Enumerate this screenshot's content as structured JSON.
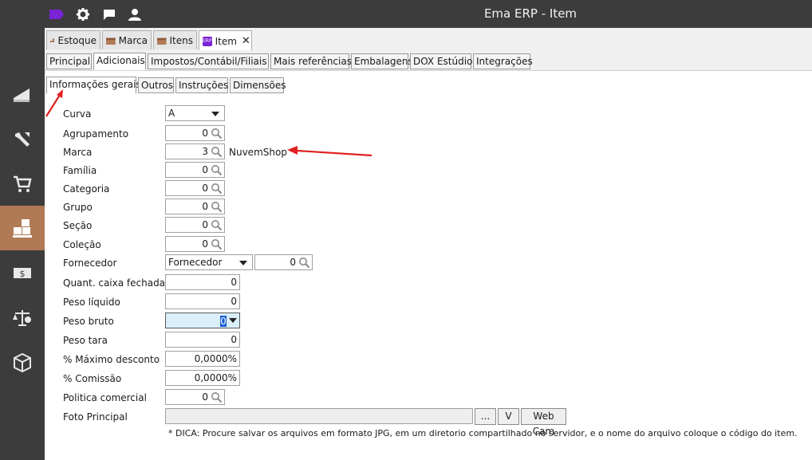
{
  "window": {
    "title": "Ema ERP - Item"
  },
  "doc_tabs": [
    {
      "label": "Estoque"
    },
    {
      "label": "Marca"
    },
    {
      "label": "Itens"
    },
    {
      "label": "Item",
      "badge": "ERP",
      "close": "✕"
    }
  ],
  "main_tabs": [
    {
      "label": "Principal"
    },
    {
      "label": "Adicionais"
    },
    {
      "label": "Impostos/Contábil/Filiais"
    },
    {
      "label": "Mais referências"
    },
    {
      "label": "Embalagens"
    },
    {
      "label": "DOX Estúdio"
    },
    {
      "label": "Integrações"
    }
  ],
  "sub_tabs": [
    {
      "label": "Informações gerais"
    },
    {
      "label": "Outros"
    },
    {
      "label": "Instruções"
    },
    {
      "label": "Dimensões"
    }
  ],
  "form": {
    "curva": {
      "label": "Curva",
      "value": "A"
    },
    "agrupamento": {
      "label": "Agrupamento",
      "value": "0"
    },
    "marca": {
      "label": "Marca",
      "value": "3",
      "description": "NuvemShop"
    },
    "familia": {
      "label": "Família",
      "value": "0"
    },
    "categoria": {
      "label": "Categoria",
      "value": "0"
    },
    "grupo": {
      "label": "Grupo",
      "value": "0"
    },
    "secao": {
      "label": "Seção",
      "value": "0"
    },
    "colecao": {
      "label": "Coleção",
      "value": "0"
    },
    "fornecedor": {
      "label": "Fornecedor",
      "type_value": "Fornecedor",
      "value": "0"
    },
    "quant_caixa": {
      "label": "Quant. caixa fechada",
      "value": "0"
    },
    "peso_liquido": {
      "label": "Peso líquido",
      "value": "0"
    },
    "peso_bruto": {
      "label": "Peso bruto",
      "value": "0"
    },
    "peso_tara": {
      "label": "Peso tara",
      "value": "0"
    },
    "max_desconto": {
      "label": "% Máximo desconto",
      "value": "0,0000%"
    },
    "comissao": {
      "label": "% Comissão",
      "value": "0,0000%"
    },
    "politica": {
      "label": "Politica comercial",
      "value": "0"
    },
    "foto": {
      "label": "Foto Principal",
      "value": "",
      "browse": "...",
      "view": "V",
      "webcam": "Web Cam"
    }
  },
  "hint": "* DICA: Procure salvar os arquivos em formato JPG, em um diretorio compartilhado no servidor, e o nome do arquivo coloque o código do item.",
  "colors": {
    "chrome": "#3c3c3c",
    "sidebar_active": "#b07a55",
    "annotation": "#e0201e",
    "focus": "#dbeefb"
  }
}
